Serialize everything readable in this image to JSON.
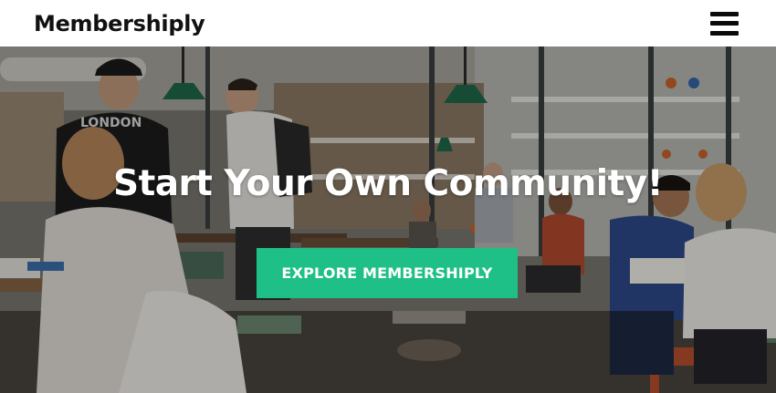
{
  "header": {
    "brand": "Membershiply",
    "menu_icon": "hamburger-menu-icon"
  },
  "hero": {
    "title": "Start Your Own Community!",
    "cta_label": "EXPLORE MEMBERSHIPLY",
    "background_image": "cafe-coworking-photo",
    "shirt_text": "LONDON"
  },
  "colors": {
    "cta_background": "#1fbf88",
    "header_background": "#ffffff",
    "brand_text": "#111111",
    "hero_text": "#ffffff"
  }
}
